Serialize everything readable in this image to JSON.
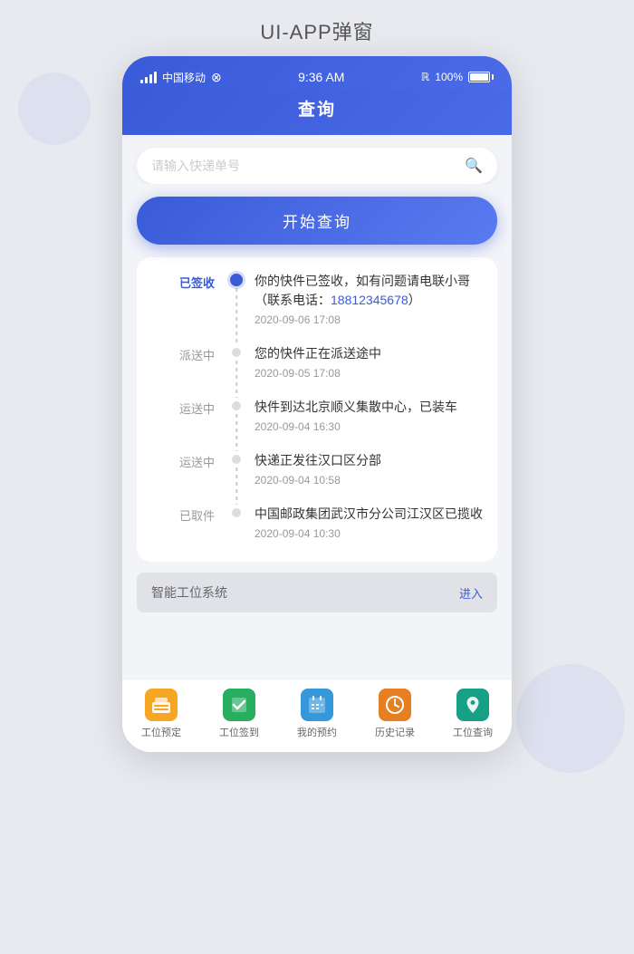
{
  "page": {
    "title": "UI-APP弹窗"
  },
  "statusBar": {
    "carrier": "中国移动",
    "time": "9:36 AM",
    "battery": "100%"
  },
  "navBar": {
    "title": "查询"
  },
  "search": {
    "placeholder": "请输入快递单号"
  },
  "queryButton": {
    "label": "开始查询"
  },
  "timeline": {
    "items": [
      {
        "status": "已签收",
        "active": true,
        "desc": "你的快件已签收，如有问题请电联小哥（联系电话：",
        "phone": "18812345678",
        "descSuffix": "）",
        "time": "2020-09-06  17:08"
      },
      {
        "status": "派送中",
        "active": false,
        "desc": "您的快件正在派送途中",
        "phone": "",
        "descSuffix": "",
        "time": "2020-09-05  17:08"
      },
      {
        "status": "运送中",
        "active": false,
        "desc": "快件到达北京顺义集散中心，已装车",
        "phone": "",
        "descSuffix": "",
        "time": "2020-09-04  16:30"
      },
      {
        "status": "运送中",
        "active": false,
        "desc": "快递正发往汉口区分部",
        "phone": "",
        "descSuffix": "",
        "time": "2020-09-04  10:58"
      },
      {
        "status": "已取件",
        "active": false,
        "desc": "中国邮政集团武汉市分公司江汉区已揽收",
        "phone": "",
        "descSuffix": "",
        "time": "2020-09-04  10:30"
      }
    ]
  },
  "banner": {
    "text": "智能工位系统",
    "link": "进入"
  },
  "bottomNav": {
    "items": [
      {
        "label": "工位预定",
        "iconColor": "amber",
        "icon": "🍔"
      },
      {
        "label": "工位签到",
        "iconColor": "green",
        "icon": "✔️"
      },
      {
        "label": "我的预约",
        "iconColor": "blue",
        "icon": "📅"
      },
      {
        "label": "历史记录",
        "iconColor": "orange",
        "icon": "🕐"
      },
      {
        "label": "工位查询",
        "iconColor": "teal",
        "icon": "📍"
      }
    ]
  }
}
